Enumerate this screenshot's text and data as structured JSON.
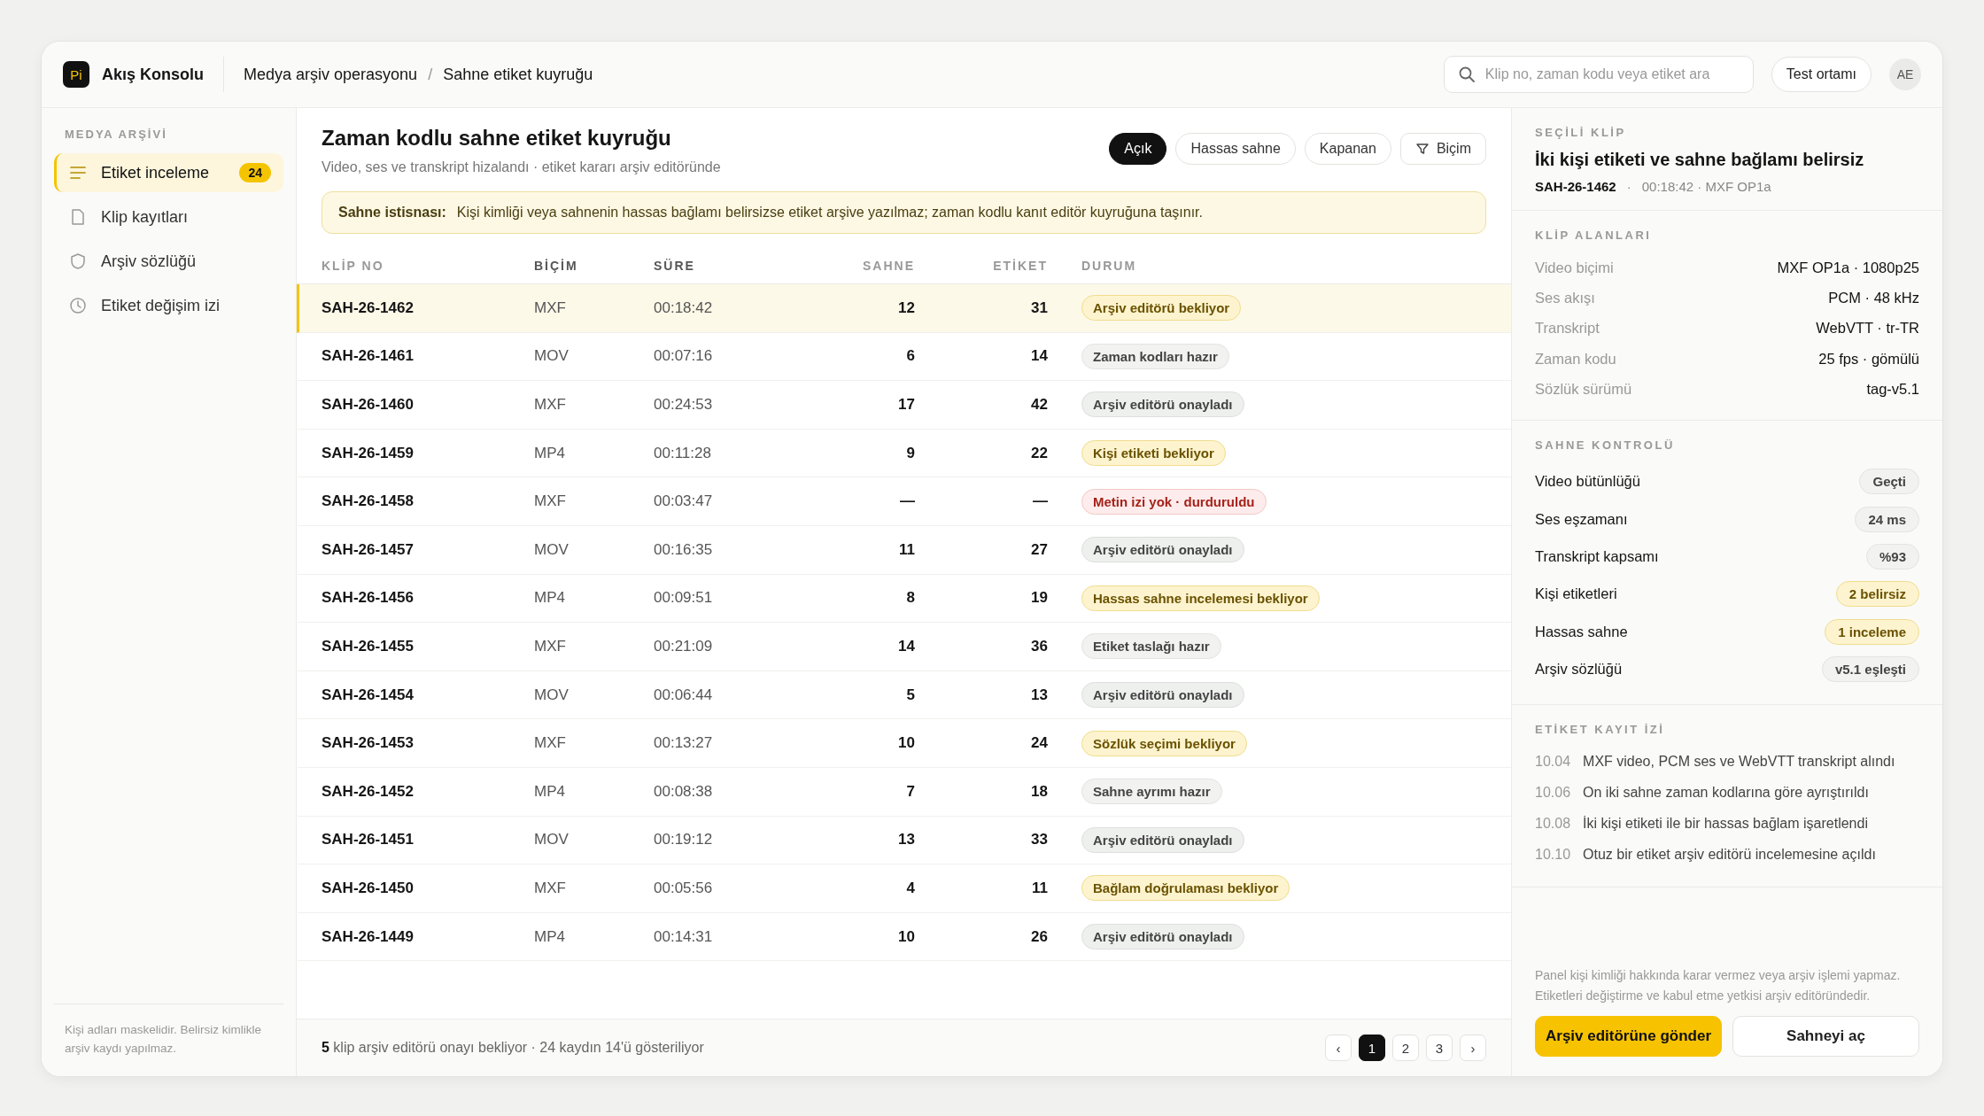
{
  "brand": {
    "logo": "Pi",
    "name": "Akış Konsolu"
  },
  "breadcrumb": {
    "items": [
      "Medya arşiv operasyonu",
      "Sahne etiket kuyruğu"
    ],
    "separator": "/"
  },
  "search": {
    "placeholder": "Klip no, zaman kodu veya etiket ara"
  },
  "env_button": "Test ortamı",
  "avatar": "AE",
  "sidebar": {
    "section": "MEDYA ARŞİVİ",
    "items": [
      {
        "label": "Etiket inceleme",
        "badge": "24",
        "selected": true
      },
      {
        "label": "Klip kayıtları",
        "selected": false
      },
      {
        "label": "Arşiv sözlüğü",
        "selected": false
      },
      {
        "label": "Etiket değişim izi",
        "selected": false
      }
    ],
    "note": "Kişi adları maskelidir. Belirsiz kimlikle arşiv kaydı yapılmaz."
  },
  "main": {
    "title": "Zaman kodlu sahne etiket kuyruğu",
    "subtitle": "Video, ses ve transkript hizalandı · etiket kararı arşiv editöründe",
    "filters": [
      {
        "label": "Açık",
        "selected": true
      },
      {
        "label": "Hassas sahne",
        "selected": false
      },
      {
        "label": "Kapanan",
        "selected": false
      }
    ],
    "format_button": "Biçim",
    "alert": {
      "label": "Sahne istisnası:",
      "text": "Kişi kimliği veya sahnenin hassas bağlamı belirsizse etiket arşive yazılmaz; zaman kodlu kanıt editör kuyruğuna taşınır."
    }
  },
  "table": {
    "columns": [
      "KLİP NO",
      "BİÇİM",
      "SÜRE",
      "SAHNE",
      "ETİKET",
      "DURUM"
    ],
    "rows": [
      {
        "clip": "SAH-26-1462",
        "format": "MXF",
        "duration": "00:18:42",
        "scenes": "12",
        "tags": "31",
        "status": "Arşiv editörü bekliyor",
        "kind": "warn",
        "selected": true
      },
      {
        "clip": "SAH-26-1461",
        "format": "MOV",
        "duration": "00:07:16",
        "scenes": "6",
        "tags": "14",
        "status": "Zaman kodları hazır",
        "kind": "neutral",
        "selected": false
      },
      {
        "clip": "SAH-26-1460",
        "format": "MXF",
        "duration": "00:24:53",
        "scenes": "17",
        "tags": "42",
        "status": "Arşiv editörü onayladı",
        "kind": "done",
        "selected": false
      },
      {
        "clip": "SAH-26-1459",
        "format": "MP4",
        "duration": "00:11:28",
        "scenes": "9",
        "tags": "22",
        "status": "Kişi etiketi bekliyor",
        "kind": "warn",
        "selected": false
      },
      {
        "clip": "SAH-26-1458",
        "format": "MXF",
        "duration": "00:03:47",
        "scenes": "—",
        "tags": "—",
        "status": "Metin izi yok · durduruldu",
        "kind": "error",
        "selected": false
      },
      {
        "clip": "SAH-26-1457",
        "format": "MOV",
        "duration": "00:16:35",
        "scenes": "11",
        "tags": "27",
        "status": "Arşiv editörü onayladı",
        "kind": "done",
        "selected": false
      },
      {
        "clip": "SAH-26-1456",
        "format": "MP4",
        "duration": "00:09:51",
        "scenes": "8",
        "tags": "19",
        "status": "Hassas sahne incelemesi bekliyor",
        "kind": "warn",
        "selected": false
      },
      {
        "clip": "SAH-26-1455",
        "format": "MXF",
        "duration": "00:21:09",
        "scenes": "14",
        "tags": "36",
        "status": "Etiket taslağı hazır",
        "kind": "neutral",
        "selected": false
      },
      {
        "clip": "SAH-26-1454",
        "format": "MOV",
        "duration": "00:06:44",
        "scenes": "5",
        "tags": "13",
        "status": "Arşiv editörü onayladı",
        "kind": "done",
        "selected": false
      },
      {
        "clip": "SAH-26-1453",
        "format": "MXF",
        "duration": "00:13:27",
        "scenes": "10",
        "tags": "24",
        "status": "Sözlük seçimi bekliyor",
        "kind": "warn",
        "selected": false
      },
      {
        "clip": "SAH-26-1452",
        "format": "MP4",
        "duration": "00:08:38",
        "scenes": "7",
        "tags": "18",
        "status": "Sahne ayrımı hazır",
        "kind": "neutral",
        "selected": false
      },
      {
        "clip": "SAH-26-1451",
        "format": "MOV",
        "duration": "00:19:12",
        "scenes": "13",
        "tags": "33",
        "status": "Arşiv editörü onayladı",
        "kind": "done",
        "selected": false
      },
      {
        "clip": "SAH-26-1450",
        "format": "MXF",
        "duration": "00:05:56",
        "scenes": "4",
        "tags": "11",
        "status": "Bağlam doğrulaması bekliyor",
        "kind": "warn",
        "selected": false
      },
      {
        "clip": "SAH-26-1449",
        "format": "MP4",
        "duration": "00:14:31",
        "scenes": "10",
        "tags": "26",
        "status": "Arşiv editörü onayladı",
        "kind": "done",
        "selected": false
      }
    ]
  },
  "footer": {
    "summary": "**5** klip arşiv editörü onayı bekliyor · 24 kaydın 14'ü gösteriliyor",
    "prev": "‹",
    "pages": [
      {
        "label": "1",
        "selected": true
      },
      {
        "label": "2",
        "selected": false
      },
      {
        "label": "3",
        "selected": false
      }
    ],
    "next": "›"
  },
  "detail": {
    "section": "SEÇİLİ KLİP",
    "title": "İki kişi etiketi ve sahne bağlamı belirsiz",
    "clip": "SAH-26-1462",
    "meta_separator": "·",
    "meta": "00:18:42 · MXF OP1a",
    "fields_title": "KLİP ALANLARI",
    "fields": [
      {
        "label": "Video biçimi",
        "value": "MXF OP1a · 1080p25"
      },
      {
        "label": "Ses akışı",
        "value": "PCM · 48 kHz"
      },
      {
        "label": "Transkript",
        "value": "WebVTT · tr-TR"
      },
      {
        "label": "Zaman kodu",
        "value": "25 fps · gömülü"
      },
      {
        "label": "Sözlük sürümü",
        "value": "tag-v5.1"
      }
    ],
    "checks_title": "SAHNE KONTROLÜ",
    "checks": [
      {
        "label": "Video bütünlüğü",
        "value": "Geçti",
        "kind": "neutral"
      },
      {
        "label": "Ses eşzamanı",
        "value": "24 ms",
        "kind": "neutral"
      },
      {
        "label": "Transkript kapsamı",
        "value": "%93",
        "kind": "neutral"
      },
      {
        "label": "Kişi etiketleri",
        "value": "2 belirsiz",
        "kind": "warn"
      },
      {
        "label": "Hassas sahne",
        "value": "1 inceleme",
        "kind": "warn"
      },
      {
        "label": "Arşiv sözlüğü",
        "value": "v5.1 eşleşti",
        "kind": "neutral"
      }
    ],
    "log_title": "ETİKET KAYIT İZİ",
    "log": [
      {
        "time": "10.04",
        "text": "MXF video, PCM ses ve WebVTT transkript alındı"
      },
      {
        "time": "10.06",
        "text": "On iki sahne zaman kodlarına göre ayrıştırıldı"
      },
      {
        "time": "10.08",
        "text": "İki kişi etiketi ile bir hassas bağlam işaretlendi"
      },
      {
        "time": "10.10",
        "text": "Otuz bir etiket arşiv editörü incelemesine açıldı"
      }
    ],
    "note": "Panel kişi kimliği hakkında karar vermez veya arşiv işlemi yapmaz. Etiketleri değiştirme ve kabul etme yetkisi arşiv editöründedir.",
    "primary_button": "Arşiv editörüne gönder",
    "secondary_button": "Sahneyi aç"
  }
}
